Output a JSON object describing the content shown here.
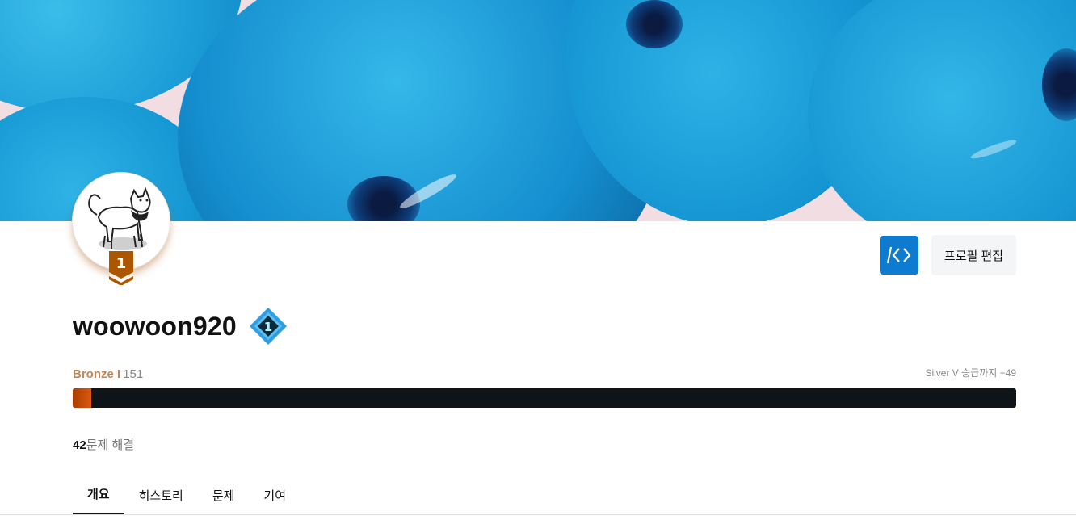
{
  "profile": {
    "username": "woowoon920",
    "rank_badge_number": "1",
    "class_badge_number": "1",
    "edit_label": "프로필 편집"
  },
  "tier": {
    "name": "Bronze I",
    "rating": "151",
    "promotion_text": "Silver V 승급까지 −49",
    "progress_fraction": 0.02,
    "progress_color": "#ad3d00"
  },
  "stats": {
    "solved_count": "42",
    "solved_label": "문제 해결"
  },
  "tabs": [
    {
      "label": "개요",
      "active": true
    },
    {
      "label": "히스토리",
      "active": false
    },
    {
      "label": "문제",
      "active": false
    },
    {
      "label": "기여",
      "active": false
    }
  ],
  "colors": {
    "accent": "#0d7bd0",
    "bronze": "#ad5600"
  },
  "icons": {
    "action_button": "code-brackets-icon",
    "avatar": "dog-avatar-icon"
  }
}
